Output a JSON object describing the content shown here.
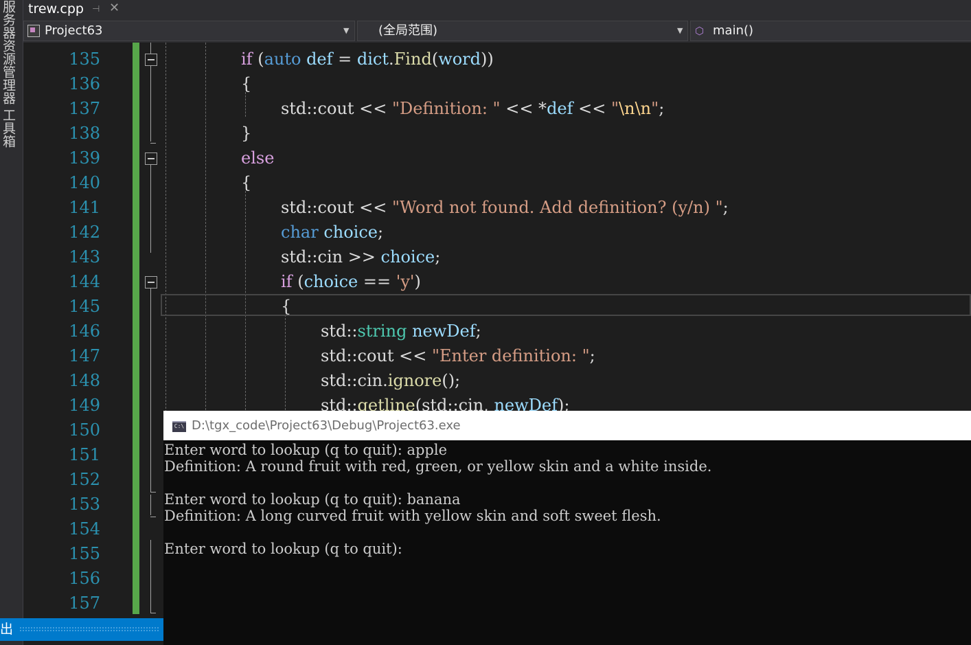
{
  "left_strip": {
    "server_explorer": "服务器资源管理器",
    "toolbox": "工具箱",
    "output_tab": "出"
  },
  "tabs": [
    {
      "label": "trew.cpp",
      "pin": "⊣",
      "close": "✕"
    }
  ],
  "nav_bar": {
    "project": "Project63",
    "scope": "(全局范围)",
    "function": "main()"
  },
  "editor": {
    "line_numbers": [
      "135",
      "136",
      "137",
      "138",
      "139",
      "140",
      "141",
      "142",
      "143",
      "144",
      "145",
      "146",
      "147",
      "148",
      "149",
      "150",
      "151",
      "152",
      "153",
      "154",
      "155",
      "156",
      "157"
    ],
    "lines": [
      [
        [
          "ctrl",
          "if"
        ],
        [
          "p",
          " ("
        ],
        [
          "kw",
          "auto"
        ],
        [
          "p",
          " "
        ],
        [
          "var",
          "def"
        ],
        [
          "p",
          " = "
        ],
        [
          "var",
          "dict"
        ],
        [
          "p",
          "."
        ],
        [
          "fn",
          "Find"
        ],
        [
          "p",
          "("
        ],
        [
          "var",
          "word"
        ],
        [
          "p",
          "))"
        ]
      ],
      [
        [
          "p",
          "{"
        ]
      ],
      [
        [
          "p",
          "std::cout << "
        ],
        [
          "str",
          "\"Definition: \""
        ],
        [
          "p",
          " << *"
        ],
        [
          "var",
          "def"
        ],
        [
          "p",
          " << "
        ],
        [
          "str",
          "\""
        ],
        [
          "esc",
          "\\n\\n"
        ],
        [
          "str",
          "\""
        ],
        [
          "p",
          ";"
        ]
      ],
      [
        [
          "p",
          "}"
        ]
      ],
      [
        [
          "ctrl",
          "else"
        ]
      ],
      [
        [
          "p",
          "{"
        ]
      ],
      [
        [
          "p",
          "std::cout << "
        ],
        [
          "str",
          "\"Word not found. Add definition? (y/n) \""
        ],
        [
          "p",
          ";"
        ]
      ],
      [
        [
          "kw",
          "char"
        ],
        [
          "p",
          " "
        ],
        [
          "var",
          "choice"
        ],
        [
          "p",
          ";"
        ]
      ],
      [
        [
          "p",
          "std::cin >> "
        ],
        [
          "var",
          "choice"
        ],
        [
          "p",
          ";"
        ]
      ],
      [
        [
          "ctrl",
          "if"
        ],
        [
          "p",
          " ("
        ],
        [
          "var",
          "choice"
        ],
        [
          "p",
          " == "
        ],
        [
          "str",
          "'y'"
        ],
        [
          "p",
          ")"
        ]
      ],
      [
        [
          "p",
          "{"
        ]
      ],
      [
        [
          "p",
          "std::"
        ],
        [
          "type",
          "string"
        ],
        [
          "p",
          " "
        ],
        [
          "var",
          "newDef"
        ],
        [
          "p",
          ";"
        ]
      ],
      [
        [
          "p",
          "std::cout << "
        ],
        [
          "str",
          "\"Enter definition: \""
        ],
        [
          "p",
          ";"
        ]
      ],
      [
        [
          "p",
          "std::cin."
        ],
        [
          "fn",
          "ignore"
        ],
        [
          "p",
          "();"
        ]
      ],
      [
        [
          "p",
          "std::"
        ],
        [
          "fn",
          "getline"
        ],
        [
          "p",
          "(std::cin, "
        ],
        [
          "var",
          "newDef"
        ],
        [
          "p",
          ");"
        ]
      ]
    ]
  },
  "console": {
    "title": "D:\\tgx_code\\Project63\\Debug\\Project63.exe",
    "icon_text": "C:\\",
    "lines": [
      "Enter word to lookup (q to quit): apple",
      "Definition: A round fruit with red, green, or yellow skin and a white inside.",
      "",
      "Enter word to lookup (q to quit): banana",
      "Definition: A long curved fruit with yellow skin and soft sweet flesh.",
      "",
      "Enter word to lookup (q to quit):"
    ]
  },
  "colors": {
    "keyword": "#569cd6",
    "control": "#d8a0df",
    "variable": "#9cdcfe",
    "function": "#dcdcaa",
    "string": "#d69d85",
    "type": "#4ec9b0",
    "line_number": "#2b91af",
    "change_bar": "#57a64a",
    "accent": "#007acc"
  }
}
